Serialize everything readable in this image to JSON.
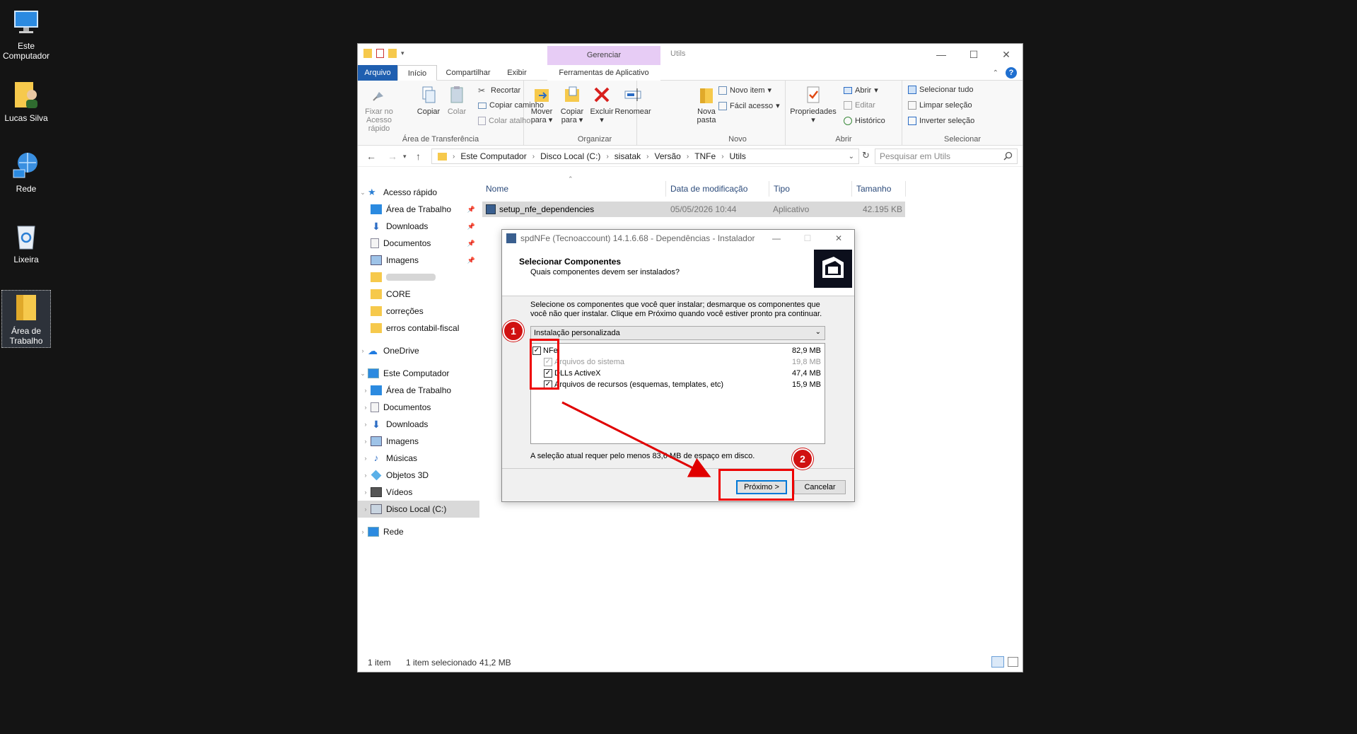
{
  "desktop": {
    "icons": [
      {
        "label": "Este Computador"
      },
      {
        "label": "Lucas Silva"
      },
      {
        "label": "Rede"
      },
      {
        "label": "Lixeira"
      },
      {
        "label": "Área de Trabalho"
      }
    ]
  },
  "explorer": {
    "context_tab": "Gerenciar",
    "title": "Utils",
    "tabs": [
      "Arquivo",
      "Início",
      "Compartilhar",
      "Exibir",
      "Ferramentas de Aplicativo"
    ],
    "ribbon": {
      "clipboard": {
        "pin": "Fixar no Acesso rápido",
        "copy": "Copiar",
        "paste": "Colar",
        "cut": "Recortar",
        "copy_path": "Copiar caminho",
        "paste_shortcut": "Colar atalho",
        "label": "Área de Transferência"
      },
      "organize": {
        "move": "Mover para",
        "copy_to": "Copiar para",
        "delete": "Excluir",
        "rename": "Renomear",
        "label": "Organizar"
      },
      "new": {
        "new_folder": "Nova pasta",
        "new_item": "Novo item",
        "easy_access": "Fácil acesso",
        "label": "Novo"
      },
      "open": {
        "properties": "Propriedades",
        "open": "Abrir",
        "edit": "Editar",
        "history": "Histórico",
        "label": "Abrir"
      },
      "select": {
        "select_all": "Selecionar tudo",
        "select_none": "Limpar seleção",
        "invert": "Inverter seleção",
        "label": "Selecionar"
      }
    },
    "path": [
      "Este Computador",
      "Disco Local (C:)",
      "sisatak",
      "Versão",
      "TNFe",
      "Utils"
    ],
    "search_placeholder": "Pesquisar em Utils",
    "nav": {
      "quick_access": "Acesso rápido",
      "quick_items": [
        "Área de Trabalho",
        "Downloads",
        "Documentos",
        "Imagens"
      ],
      "folders": [
        "CORE",
        "correções",
        "erros contabil-fiscal"
      ],
      "onedrive": "OneDrive",
      "this_pc": "Este Computador",
      "pc_items": [
        "Área de Trabalho",
        "Documentos",
        "Downloads",
        "Imagens",
        "Músicas",
        "Objetos 3D",
        "Vídeos",
        "Disco Local (C:)"
      ],
      "network": "Rede"
    },
    "columns": [
      "Nome",
      "Data de modificação",
      "Tipo",
      "Tamanho"
    ],
    "files": [
      {
        "name": "setup_nfe_dependencies",
        "modified": "05/05/2026 10:44",
        "type": "Aplicativo",
        "size": "42.195 KB"
      }
    ],
    "status": {
      "count": "1 item",
      "selected": "1 item selecionado",
      "size": "41,2 MB"
    }
  },
  "dialog": {
    "title": "spdNFe (Tecnoaccount) 14.1.6.68 - Dependências - Instalador",
    "heading": "Selecionar Componentes",
    "subheading": "Quais componentes devem ser instalados?",
    "description": "Selecione os componentes que você quer instalar; desmarque os componentes que você não quer instalar. Clique em Próximo quando você estiver pronto pra continuar.",
    "install_type": "Instalação personalizada",
    "components": [
      {
        "name": "NFe",
        "size": "82,9 MB"
      },
      {
        "name": "Arquivos do sistema",
        "size": "19,8 MB"
      },
      {
        "name": "DLLs ActiveX",
        "size": "47,4 MB"
      },
      {
        "name": "Arquivos de recursos (esquemas, templates, etc)",
        "size": "15,9 MB"
      }
    ],
    "requirement": "A seleção atual requer pelo menos 83,6 MB de espaço em disco.",
    "next_button": "Próximo >",
    "cancel_button": "Cancelar"
  },
  "annotations": {
    "step1": "1",
    "step2": "2",
    "color": "#e00000"
  }
}
